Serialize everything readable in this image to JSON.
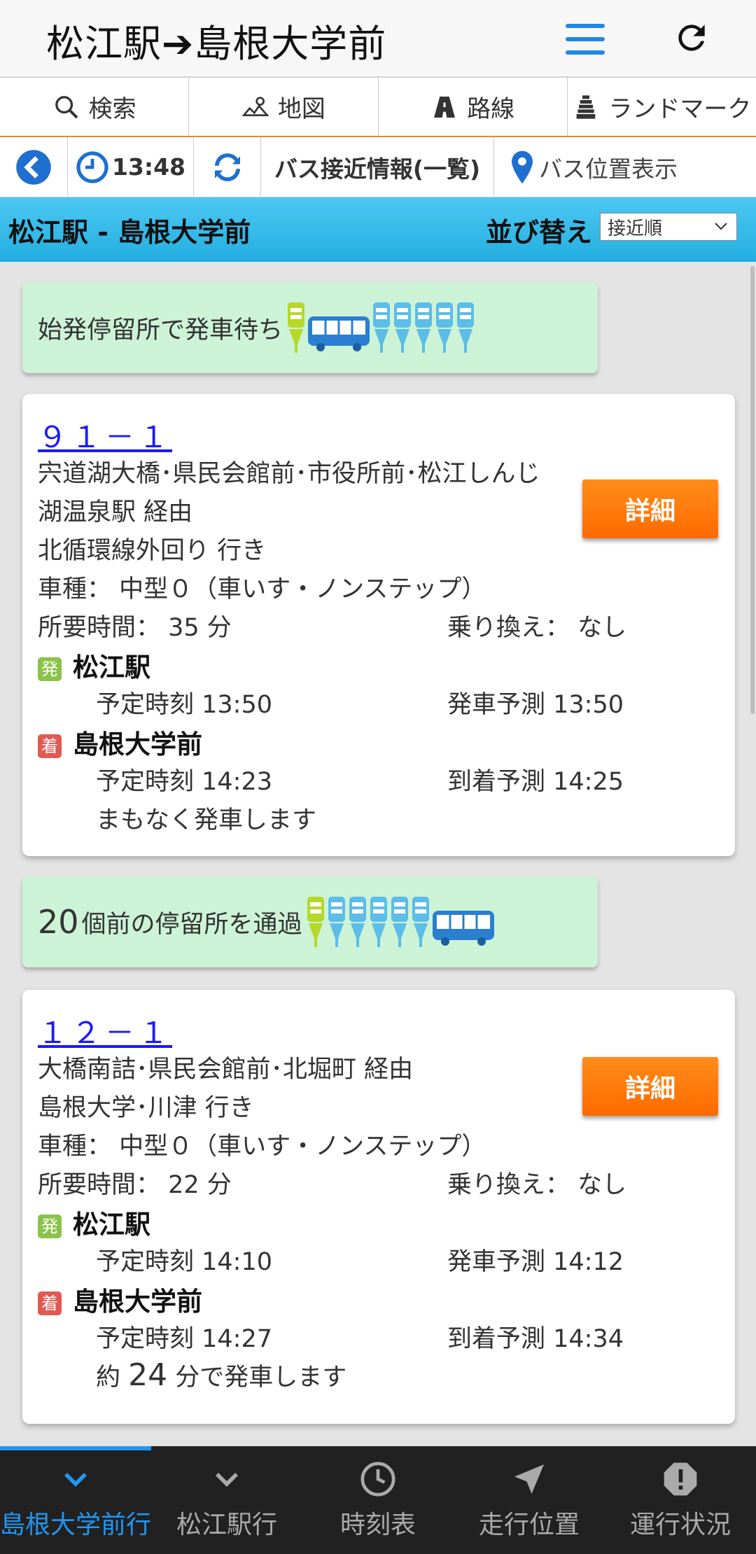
{
  "header": {
    "title": "松江駅➔島根大学前"
  },
  "navtabs": [
    {
      "label": "検索",
      "icon": "search-icon"
    },
    {
      "label": "地図",
      "icon": "map-icon"
    },
    {
      "label": "路線",
      "icon": "road-icon"
    },
    {
      "label": "ランドマーク",
      "icon": "landmark-icon"
    }
  ],
  "toolbar": {
    "time": "13:48",
    "info": "バス接近情報(一覧)",
    "position": "バス位置表示"
  },
  "route_bar": {
    "route": "松江駅 - 島根大学前",
    "sort_label": "並び替え",
    "sort_value": "接近順"
  },
  "accent_colors": {
    "blue": "#22aee0",
    "orange": "#ff6a00",
    "green_status": "#cdf3d7",
    "active_tab": "#2196f3"
  },
  "buses": [
    {
      "status_prefix": "",
      "status_text": "始発停留所で発車待ち",
      "route_number": "９１－１",
      "via_line1": "宍道湖大橋･県民会館前･市役所前･松江しんじ",
      "via_line2": "湖温泉駅  経由",
      "destination": "北循環線外回り 行き",
      "vehicle": "車種： 中型０（車いす・ノンステップ）",
      "duration": "所要時間： 35 分",
      "transfer": "乗り換え： なし",
      "dep_badge": "発",
      "dep_stop": "松江駅",
      "dep_scheduled": "予定時刻 13:50",
      "dep_predicted": "発車予測 13:50",
      "arr_badge": "着",
      "arr_stop": "島根大学前",
      "arr_scheduled": "予定時刻 14:23",
      "arr_predicted": "到着予測 14:25",
      "message": "まもなく発車します",
      "detail_label": "詳細"
    },
    {
      "status_prefix": "20",
      "status_text": " 個前の停留所を通過",
      "route_number": "１２－１",
      "via_line1": "大橋南詰･県民会館前･北堀町  経由",
      "via_line2": "島根大学･川津 行き",
      "vehicle": "車種： 中型０（車いす・ノンステップ）",
      "duration": "所要時間： 22 分",
      "transfer": "乗り換え： なし",
      "dep_badge": "発",
      "dep_stop": "松江駅",
      "dep_scheduled": "予定時刻 14:10",
      "dep_predicted": "発車予測 14:12",
      "arr_badge": "着",
      "arr_stop": "島根大学前",
      "arr_scheduled": "予定時刻 14:27",
      "arr_predicted": "到着予測 14:34",
      "message_pre": "約 ",
      "message_num": "24",
      "message_post": " 分で発車します",
      "detail_label": "詳細"
    }
  ],
  "bottom_nav": [
    {
      "label": "島根大学前行",
      "icon": "chevron-down-icon",
      "active": true
    },
    {
      "label": "松江駅行",
      "icon": "chevron-down-icon"
    },
    {
      "label": "時刻表",
      "icon": "clock-icon"
    },
    {
      "label": "走行位置",
      "icon": "navigation-arrow-icon"
    },
    {
      "label": "運行状況",
      "icon": "alert-icon"
    }
  ]
}
